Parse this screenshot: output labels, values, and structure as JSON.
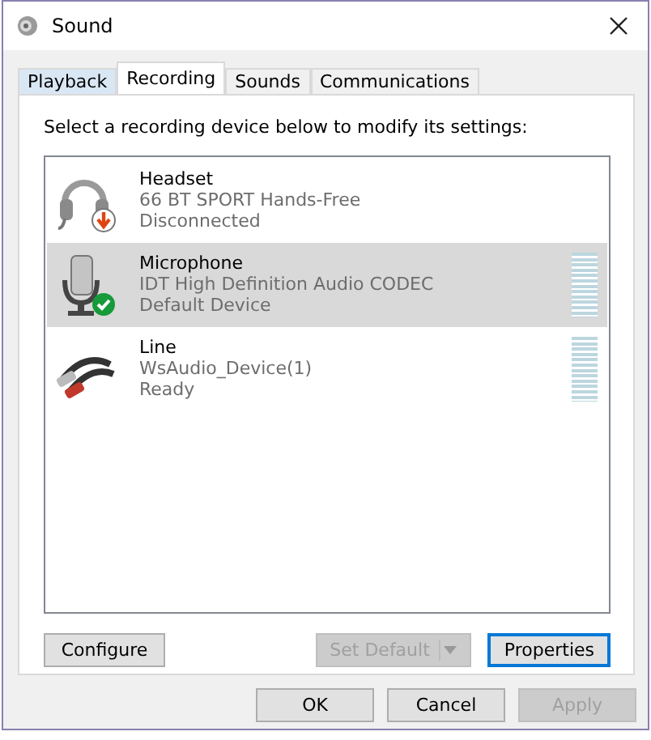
{
  "window": {
    "title": "Sound"
  },
  "tabs": [
    {
      "label": "Playback",
      "selected": false
    },
    {
      "label": "Recording",
      "selected": true
    },
    {
      "label": "Sounds",
      "selected": false
    },
    {
      "label": "Communications",
      "selected": false
    }
  ],
  "instruction": "Select a recording device below to modify its settings:",
  "devices": [
    {
      "kind": "headset",
      "name": "Headset",
      "detail": "66 BT SPORT Hands-Free",
      "status": "Disconnected",
      "connected": false,
      "default": false,
      "selected": false,
      "meter": false
    },
    {
      "kind": "microphone",
      "name": "Microphone",
      "detail": "IDT High Definition Audio CODEC",
      "status": "Default Device",
      "connected": true,
      "default": true,
      "selected": true,
      "meter": true
    },
    {
      "kind": "line",
      "name": "Line",
      "detail": "WsAudio_Device(1)",
      "status": "Ready",
      "connected": true,
      "default": false,
      "selected": false,
      "meter": true
    }
  ],
  "panel_buttons": [
    {
      "label": "Configure",
      "disabled": false,
      "split": false,
      "focused": false
    },
    {
      "label": "Set Default",
      "disabled": true,
      "split": true,
      "focused": false
    },
    {
      "label": "Properties",
      "disabled": false,
      "split": false,
      "focused": true
    }
  ],
  "dialog_buttons": [
    {
      "label": "OK",
      "disabled": false
    },
    {
      "label": "Cancel",
      "disabled": false
    },
    {
      "label": "Apply",
      "disabled": true
    }
  ]
}
